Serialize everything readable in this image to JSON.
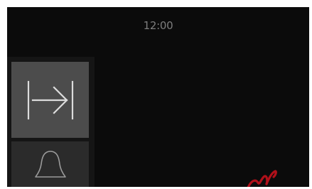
{
  "status_bar": {
    "time": "12:00"
  },
  "side_panel": {
    "tiles": [
      {
        "icon": "skip-to-end-icon",
        "state": "selected"
      },
      {
        "icon": "bell-icon",
        "state": "normal"
      }
    ]
  },
  "colors": {
    "screen_bg": "#0b0b0b",
    "panel_bg": "#151515",
    "tile_selected": "#4c4c4c",
    "tile_normal": "#2b2b2b",
    "icon_stroke": "#dcdcdc",
    "clock_text": "#7d7d7d",
    "ink_mark": "#b0101a"
  }
}
